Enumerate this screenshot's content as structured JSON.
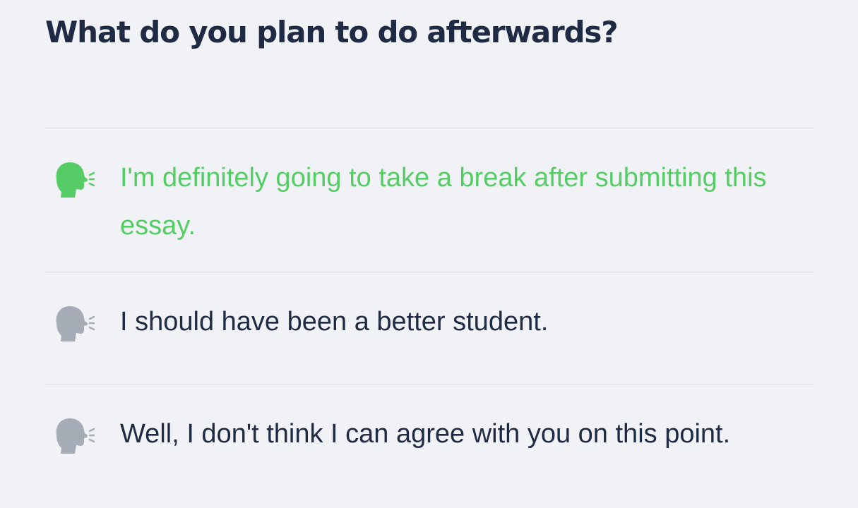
{
  "question": {
    "title": "What do you plan to do afterwards?"
  },
  "options": [
    {
      "text": "I'm definitely going to take a break after submitting this essay.",
      "selected": true,
      "icon": "speaking-head-icon",
      "color": "#56cc67"
    },
    {
      "text": "I should have been a better student.",
      "selected": false,
      "icon": "speaking-head-icon",
      "color": "#a6acb5"
    },
    {
      "text": "Well, I don't think I can agree with you on this point.",
      "selected": false,
      "icon": "speaking-head-icon",
      "color": "#a6acb5"
    }
  ],
  "colors": {
    "background": "#f1f2f5",
    "text": "#1f2a44",
    "selected": "#56cc67",
    "icon_inactive": "#a6acb5",
    "divider": "#dfe1e6"
  }
}
